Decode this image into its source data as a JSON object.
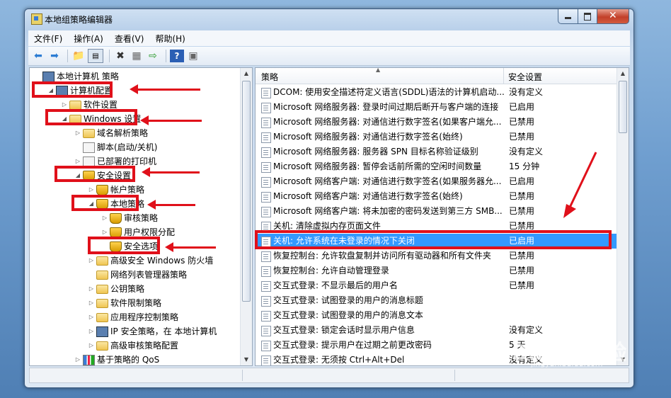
{
  "window": {
    "title": "本地组策略编辑器"
  },
  "menu": [
    "文件(F)",
    "操作(A)",
    "查看(V)",
    "帮助(H)"
  ],
  "tree": [
    {
      "label": "本地计算机 策略",
      "level": 0,
      "arrow": "",
      "icon": "computer"
    },
    {
      "label": "计算机配置",
      "level": 1,
      "arrow": "◢",
      "icon": "computer"
    },
    {
      "label": "软件设置",
      "level": 2,
      "arrow": "▷",
      "icon": "folder"
    },
    {
      "label": "Windows 设置",
      "level": 2,
      "arrow": "◢",
      "icon": "folder"
    },
    {
      "label": "域名解析策略",
      "level": 3,
      "arrow": "▷",
      "icon": "folder"
    },
    {
      "label": "脚本(启动/关机)",
      "level": 3,
      "arrow": "",
      "icon": "doc"
    },
    {
      "label": "已部署的打印机",
      "level": 3,
      "arrow": "▷",
      "icon": "doc"
    },
    {
      "label": "安全设置",
      "level": 3,
      "arrow": "◢",
      "icon": "shield"
    },
    {
      "label": "帐户策略",
      "level": 4,
      "arrow": "▷",
      "icon": "shield"
    },
    {
      "label": "本地策略",
      "level": 4,
      "arrow": "◢",
      "icon": "shield"
    },
    {
      "label": "审核策略",
      "level": 5,
      "arrow": "▷",
      "icon": "shield"
    },
    {
      "label": "用户权限分配",
      "level": 5,
      "arrow": "▷",
      "icon": "shield"
    },
    {
      "label": "安全选项",
      "level": 5,
      "arrow": "",
      "icon": "shield"
    },
    {
      "label": "高级安全 Windows 防火墙",
      "level": 4,
      "arrow": "▷",
      "icon": "folder"
    },
    {
      "label": "网络列表管理器策略",
      "level": 4,
      "arrow": "",
      "icon": "folder"
    },
    {
      "label": "公钥策略",
      "level": 4,
      "arrow": "▷",
      "icon": "folder"
    },
    {
      "label": "软件限制策略",
      "level": 4,
      "arrow": "▷",
      "icon": "folder"
    },
    {
      "label": "应用程序控制策略",
      "level": 4,
      "arrow": "▷",
      "icon": "folder"
    },
    {
      "label": "IP 安全策略，在 本地计算机",
      "level": 4,
      "arrow": "▷",
      "icon": "computer"
    },
    {
      "label": "高级审核策略配置",
      "level": 4,
      "arrow": "▷",
      "icon": "folder"
    },
    {
      "label": "基于策略的 QoS",
      "level": 3,
      "arrow": "▷",
      "icon": "chart"
    }
  ],
  "table": {
    "col_policy": "策略",
    "col_setting": "安全设置",
    "rows": [
      {
        "name": "DCOM: 使用安全描述符定义语言(SDDL)语法的计算机启动...",
        "setting": "没有定义"
      },
      {
        "name": "Microsoft 网络服务器: 登录时间过期后断开与客户端的连接",
        "setting": "已启用"
      },
      {
        "name": "Microsoft 网络服务器: 对通信进行数字签名(如果客户端允...",
        "setting": "已禁用"
      },
      {
        "name": "Microsoft 网络服务器: 对通信进行数字签名(始终)",
        "setting": "已禁用"
      },
      {
        "name": "Microsoft 网络服务器: 服务器 SPN 目标名称验证级别",
        "setting": "没有定义"
      },
      {
        "name": "Microsoft 网络服务器: 暂停会话前所需的空闲时间数量",
        "setting": "15 分钟"
      },
      {
        "name": "Microsoft 网络客户端: 对通信进行数字签名(如果服务器允...",
        "setting": "已启用"
      },
      {
        "name": "Microsoft 网络客户端: 对通信进行数字签名(始终)",
        "setting": "已禁用"
      },
      {
        "name": "Microsoft 网络客户端: 将未加密的密码发送到第三方 SMB...",
        "setting": "已禁用"
      },
      {
        "name": "关机: 清除虚拟内存页面文件",
        "setting": "已禁用"
      },
      {
        "name": "关机: 允许系统在未登录的情况下关闭",
        "setting": "已启用"
      },
      {
        "name": "恢复控制台: 允许软盘复制并访问所有驱动器和所有文件夹",
        "setting": "已禁用"
      },
      {
        "name": "恢复控制台: 允许自动管理登录",
        "setting": "已禁用"
      },
      {
        "name": "交互式登录: 不显示最后的用户名",
        "setting": "已禁用"
      },
      {
        "name": "交互式登录: 试图登录的用户的消息标题",
        "setting": ""
      },
      {
        "name": "交互式登录: 试图登录的用户的消息文本",
        "setting": ""
      },
      {
        "name": "交互式登录: 锁定会话时显示用户信息",
        "setting": "没有定义"
      },
      {
        "name": "交互式登录: 提示用户在过期之前更改密码",
        "setting": "5 天"
      },
      {
        "name": "交互式登录: 无须按 Ctrl+Alt+Del",
        "setting": "没有定义"
      }
    ],
    "selected_index": 10
  },
  "watermark": {
    "brand": "Baidu经验",
    "url": "jingyan.baidu.com"
  }
}
